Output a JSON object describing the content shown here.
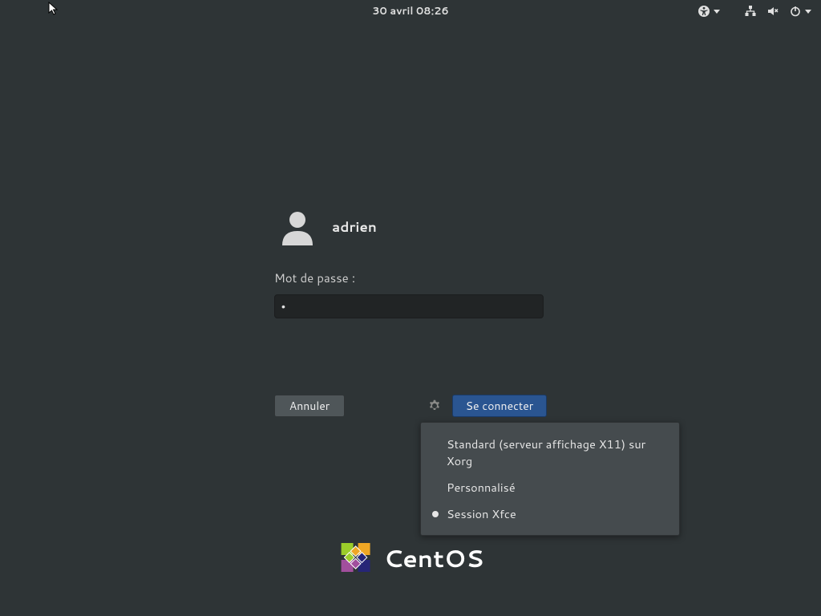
{
  "topbar": {
    "datetime": "30 avril  08:26"
  },
  "login": {
    "username": "adrien",
    "password_label": "Mot de passe :",
    "password_value": "•"
  },
  "buttons": {
    "cancel": "Annuler",
    "signin": "Se connecter"
  },
  "session_menu": {
    "items": [
      {
        "label": "Standard (serveur affichage X11) sur Xorg",
        "selected": false
      },
      {
        "label": "Personnalisé",
        "selected": false
      },
      {
        "label": "Session Xfce",
        "selected": true
      }
    ]
  },
  "branding": {
    "name": "CentOS"
  }
}
